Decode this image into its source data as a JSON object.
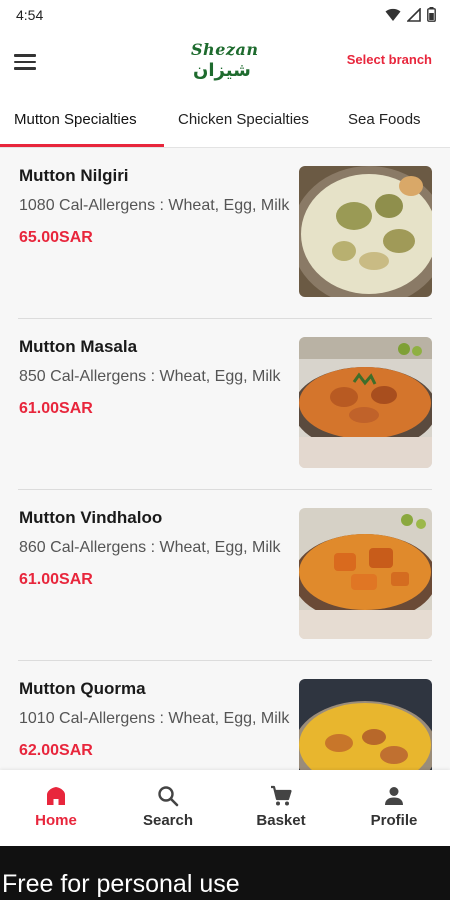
{
  "status_bar": {
    "time": "4:54",
    "icons": [
      "wifi-icon",
      "signal-icon",
      "battery-icon"
    ]
  },
  "header": {
    "logo_latin": "Shezan",
    "logo_arabic": "شيزان",
    "select_branch": "Select branch"
  },
  "tabs": [
    {
      "label": "Mutton Specialties",
      "active": true
    },
    {
      "label": "Chicken Specialties",
      "active": false
    },
    {
      "label": "Sea Foods",
      "active": false
    }
  ],
  "items": [
    {
      "name": "Mutton Nilgiri",
      "desc": "1080 Cal-Allergens : Wheat, Egg, Milk",
      "price": "65.00SAR"
    },
    {
      "name": "Mutton Masala",
      "desc": "850 Cal-Allergens : Wheat, Egg, Milk",
      "price": "61.00SAR"
    },
    {
      "name": "Mutton Vindhaloo",
      "desc": "860 Cal-Allergens : Wheat, Egg, Milk",
      "price": "61.00SAR"
    },
    {
      "name": "Mutton Quorma",
      "desc": "1010 Cal-Allergens : Wheat, Egg, Milk",
      "price": "62.00SAR"
    }
  ],
  "bottom_nav": [
    {
      "label": "Home",
      "icon": "home-icon",
      "active": true
    },
    {
      "label": "Search",
      "icon": "search-icon",
      "active": false
    },
    {
      "label": "Basket",
      "icon": "cart-icon",
      "active": false
    },
    {
      "label": "Profile",
      "icon": "person-icon",
      "active": false
    }
  ],
  "watermark": "Free for personal use",
  "colors": {
    "accent": "#e8263c",
    "brand_green": "#1e6b2e",
    "list_background": "#f7f7f7"
  }
}
